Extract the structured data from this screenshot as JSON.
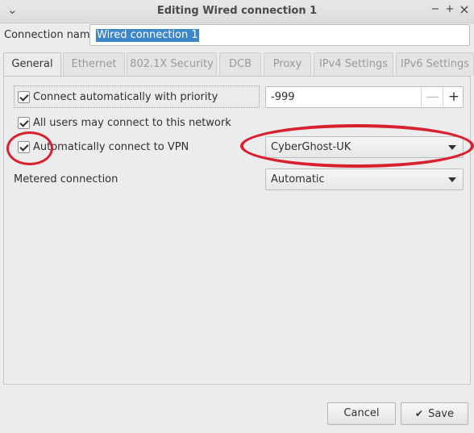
{
  "window": {
    "title": "Editing Wired connection 1",
    "controls": {
      "minimize": "−",
      "maximize": "+",
      "close": "×"
    }
  },
  "connection": {
    "label": "Connection name",
    "value": "Wired connection 1"
  },
  "tabs": [
    {
      "label": "General",
      "active": true
    },
    {
      "label": "Ethernet"
    },
    {
      "label": "802.1X Security"
    },
    {
      "label": "DCB"
    },
    {
      "label": "Proxy"
    },
    {
      "label": "IPv4 Settings"
    },
    {
      "label": "IPv6 Settings"
    }
  ],
  "general": {
    "auto_connect": {
      "label": "Connect automatically with priority",
      "checked": true
    },
    "priority": {
      "value": "-999",
      "decrement": "—",
      "increment": "+"
    },
    "all_users": {
      "label": "All users may connect to this network",
      "checked": true
    },
    "auto_vpn": {
      "label": "Automatically connect to VPN",
      "checked": true
    },
    "vpn_select": {
      "value": "CyberGhost-UK"
    },
    "metered": {
      "label": "Metered connection",
      "value": "Automatic"
    }
  },
  "buttons": {
    "cancel": "Cancel",
    "save": "Save",
    "save_icon": "✔"
  },
  "annotation_color": "#d9202e"
}
